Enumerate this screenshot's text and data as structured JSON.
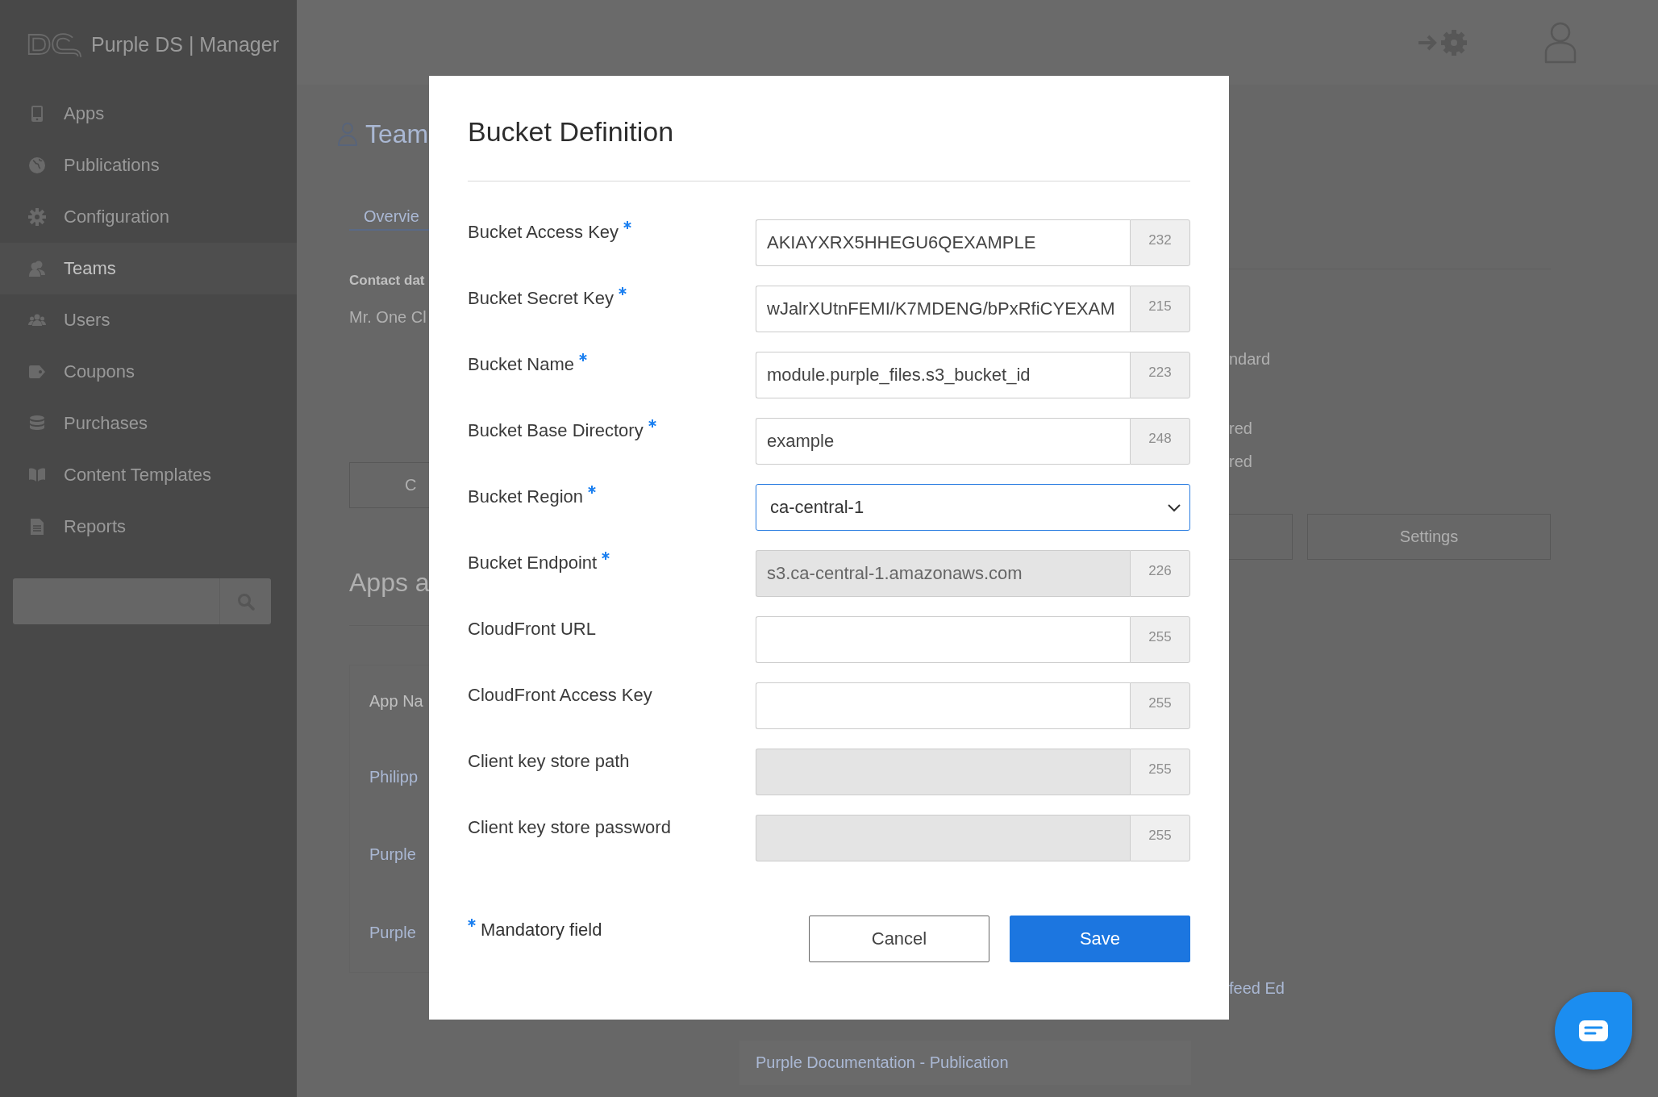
{
  "sidebar": {
    "logo_text": "Purple DS | Manager",
    "items": [
      {
        "label": "Apps",
        "selected": false
      },
      {
        "label": "Publications",
        "selected": false
      },
      {
        "label": "Configuration",
        "selected": false
      },
      {
        "label": "Teams",
        "selected": true
      },
      {
        "label": "Users",
        "selected": false
      },
      {
        "label": "Coupons",
        "selected": false
      },
      {
        "label": "Purchases",
        "selected": false
      },
      {
        "label": "Content Templates",
        "selected": false
      },
      {
        "label": "Reports",
        "selected": false
      }
    ]
  },
  "page": {
    "title": "Team",
    "tab": "Overvie",
    "contact_label": "Contact dat",
    "contact_name": "Mr. One Cl",
    "left_button": "C",
    "section_title": "Apps a",
    "table_header": "App Na",
    "table_rows": [
      "Philipp",
      "Purple",
      "Purple"
    ],
    "right_texts": [
      "ndard",
      "red",
      "red"
    ],
    "settings_button": "Settings",
    "right_row": "feed Ed",
    "bottom_row": "Purple Documentation - Publication"
  },
  "dialog": {
    "title": "Bucket Definition",
    "fields": [
      {
        "label": "Bucket Access Key",
        "required": true,
        "kind": "text",
        "disabled": false,
        "value": "AKIAYXRX5HHEGU6QEXAMPLE",
        "counter": "232"
      },
      {
        "label": "Bucket Secret Key",
        "required": true,
        "kind": "text",
        "disabled": false,
        "value": "wJalrXUtnFEMI/K7MDENG/bPxRfiCYEXAM",
        "counter": "215"
      },
      {
        "label": "Bucket Name",
        "required": true,
        "kind": "text",
        "disabled": false,
        "value": "module.purple_files.s3_bucket_id",
        "counter": "223"
      },
      {
        "label": "Bucket Base Directory",
        "required": true,
        "kind": "text",
        "disabled": false,
        "value": "example",
        "counter": "248"
      },
      {
        "label": "Bucket Region",
        "required": true,
        "kind": "select",
        "value": "ca-central-1"
      },
      {
        "label": "Bucket Endpoint",
        "required": true,
        "kind": "text",
        "disabled": true,
        "value": "s3.ca-central-1.amazonaws.com",
        "counter": "226"
      },
      {
        "label": "CloudFront URL",
        "required": false,
        "kind": "text",
        "disabled": false,
        "counter": "255"
      },
      {
        "label": "CloudFront Access Key",
        "required": false,
        "kind": "text",
        "disabled": false,
        "counter": "255"
      },
      {
        "label": "Client key store path",
        "required": false,
        "kind": "text",
        "disabled": true,
        "counter": "255"
      },
      {
        "label": "Client key store password",
        "required": false,
        "kind": "text",
        "disabled": true,
        "counter": "255"
      }
    ],
    "mandatory_note": "Mandatory field",
    "buttons": [
      {
        "label": "Cancel",
        "kind": "secondary"
      },
      {
        "label": "Save",
        "kind": "primary"
      }
    ]
  }
}
